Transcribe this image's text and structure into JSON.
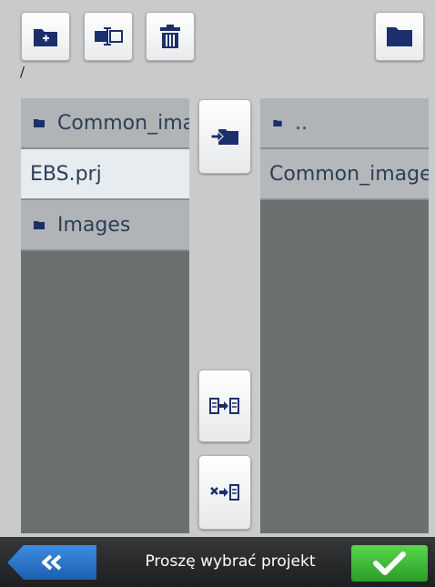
{
  "path": "/",
  "left_panel": {
    "items": [
      {
        "type": "folder",
        "label": "Common_images"
      },
      {
        "type": "file",
        "label": "EBS.prj",
        "selected": true
      },
      {
        "type": "folder",
        "label": "Images"
      }
    ]
  },
  "right_panel": {
    "items": [
      {
        "type": "folder",
        "label": ".."
      },
      {
        "type": "file",
        "label": "Common_images"
      }
    ]
  },
  "status_text": "Proszę wybrać projekt",
  "colors": {
    "icon_blue": "#1b2f6b",
    "accept_green": "#3cbf33",
    "back_blue": "#2a72c8"
  },
  "icons": {
    "toolbar": [
      "new-folder-icon",
      "rename-icon",
      "trash-icon",
      "folder-icon"
    ],
    "middle": [
      "move-into-folder-icon",
      "copy-file-icon",
      "delete-copy-icon"
    ],
    "bottom": [
      "double-chevron-left-icon",
      "checkmark-icon"
    ]
  }
}
